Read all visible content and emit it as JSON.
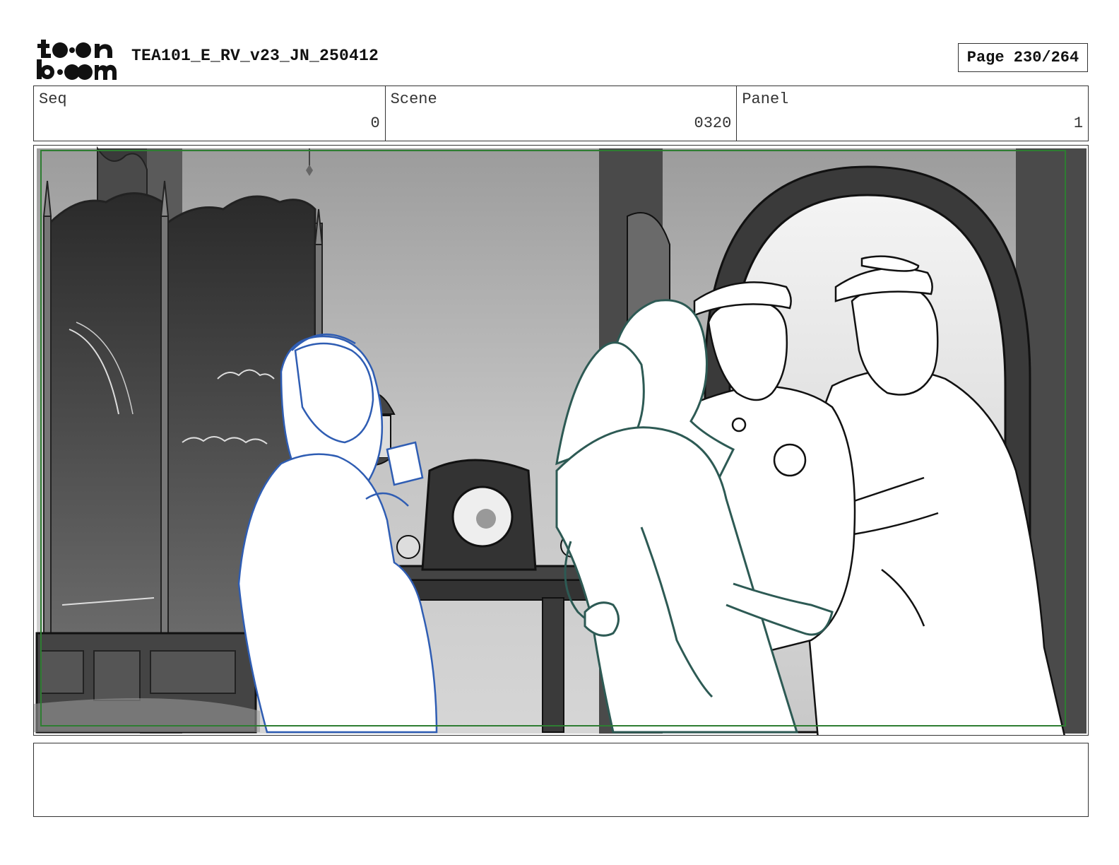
{
  "header": {
    "logo_text": "toon boom",
    "project_title": "TEA101_E_RV_v23_JN_250412",
    "page_label": "Page 230/264"
  },
  "info": {
    "seq_label": "Seq",
    "seq_value": "0",
    "scene_label": "Scene",
    "scene_value": "0320",
    "panel_label": "Panel",
    "panel_value": "1"
  },
  "panel": {
    "safe_frame_color": "#2e7d32",
    "character_colors": {
      "woman_in_white": "#2f5db3",
      "woman_center": "#2d5a54",
      "guards": "#111111"
    }
  },
  "notes": {
    "text": ""
  }
}
